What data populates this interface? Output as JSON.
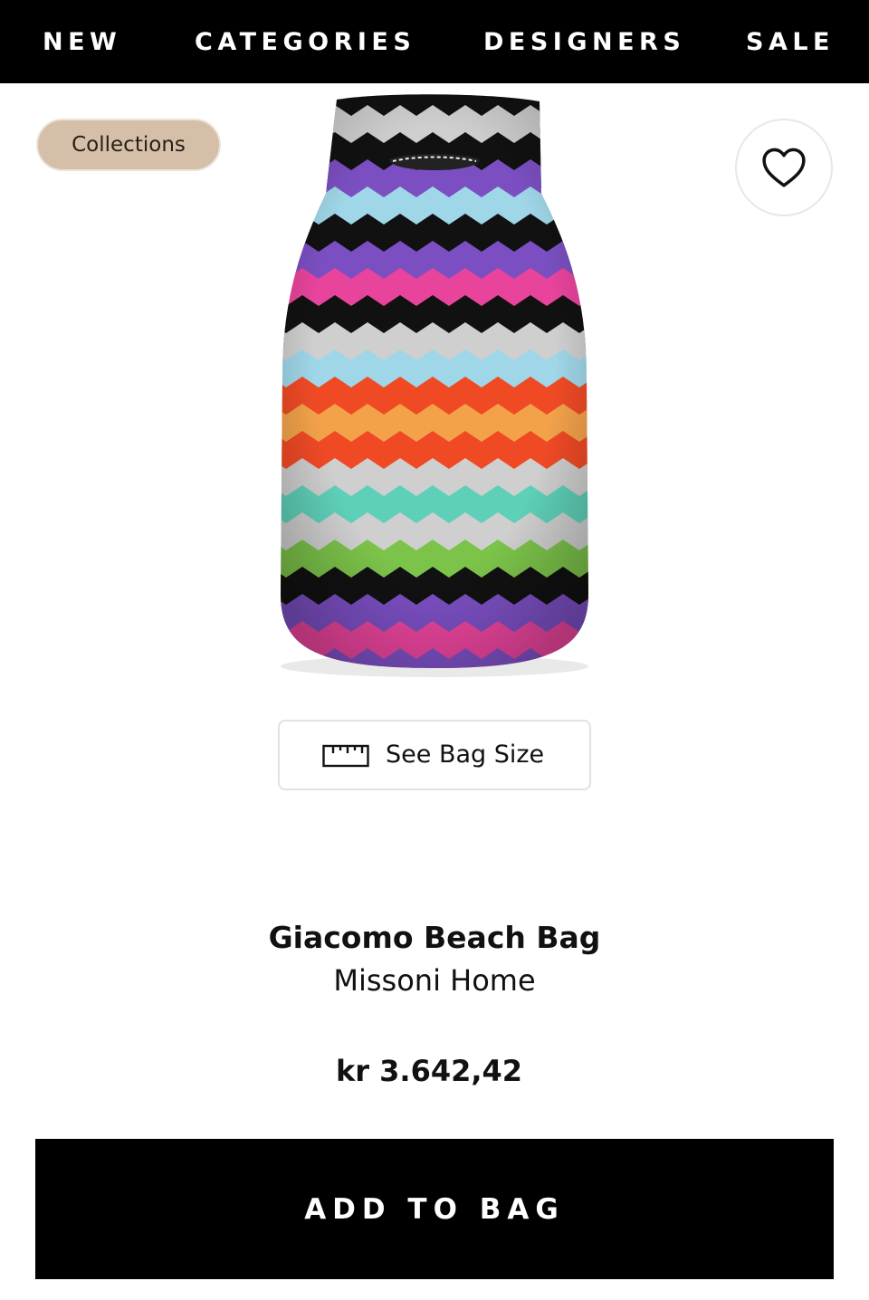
{
  "nav": {
    "items": [
      {
        "label": "NEW"
      },
      {
        "label": "CATEGORIES"
      },
      {
        "label": "DESIGNERS"
      },
      {
        "label": "SALE"
      }
    ]
  },
  "badge": {
    "label": "Collections"
  },
  "icons": {
    "wishlist": "heart-icon",
    "size": "ruler-icon"
  },
  "size_button": {
    "label": "See Bag Size"
  },
  "product": {
    "name": "Giacomo Beach Bag",
    "brand": "Missoni Home",
    "price": "kr 3.642,42"
  },
  "cta": {
    "label": "ADD TO BAG"
  },
  "colors": {
    "nav_bg": "#000000",
    "badge_bg": "#d6bfa8",
    "cta_bg": "#000000",
    "stripe_palette": [
      "#7b4fc2",
      "#e9449c",
      "#111111",
      "#9fd6e8",
      "#f04a25",
      "#f3a24a",
      "#5fd0b8",
      "#7cc34a",
      "#cfcfcf"
    ]
  }
}
